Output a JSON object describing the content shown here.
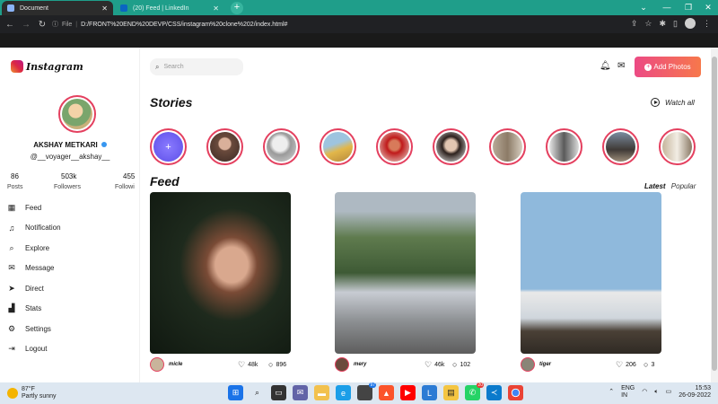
{
  "browser": {
    "tabs": [
      {
        "label": "Document",
        "active": true
      },
      {
        "label": "(20) Feed | LinkedIn",
        "active": false
      }
    ],
    "new_tab_label": "+",
    "address": {
      "scheme_label": "File",
      "url": "D:/FRONT%20END%20DEVP/CSS/instagram%20clone%202/index.html#"
    }
  },
  "sidebar": {
    "brand": "Instagram",
    "profile": {
      "name": "AKSHAY METKARI",
      "handle": "@__voyager__akshay__"
    },
    "stats": [
      {
        "value": "86",
        "label": "Posts"
      },
      {
        "value": "503k",
        "label": "Followers"
      },
      {
        "value": "455",
        "label": "Followi"
      }
    ],
    "nav": [
      {
        "label": "Feed",
        "icon": "grid-icon"
      },
      {
        "label": "Notification",
        "icon": "bell-icon"
      },
      {
        "label": "Explore",
        "icon": "search-icon"
      },
      {
        "label": "Message",
        "icon": "mail-icon"
      },
      {
        "label": "Direct",
        "icon": "send-icon"
      },
      {
        "label": "Stats",
        "icon": "stats-icon"
      },
      {
        "label": "Settings",
        "icon": "gear-icon"
      },
      {
        "label": "Logout",
        "icon": "logout-icon"
      }
    ]
  },
  "header": {
    "search_placeholder": "Search",
    "add_button": "Add Photos"
  },
  "stories": {
    "title": "Stories",
    "watch_all": "Watch all",
    "add_label": "+"
  },
  "feed": {
    "title": "Feed",
    "filter_latest": "Latest",
    "filter_popular": "Popular",
    "posts": [
      {
        "user": "micle",
        "likes": "48k",
        "comments": "896"
      },
      {
        "user": "mery",
        "likes": "46k",
        "comments": "102"
      },
      {
        "user": "tiger",
        "likes": "206",
        "comments": "3"
      }
    ]
  },
  "taskbar": {
    "weather_temp": "87°F",
    "weather_desc": "Partly sunny",
    "lang": "ENG",
    "region": "IN",
    "time": "15:53",
    "date": "26-09-2022",
    "badge_1": "97",
    "badge_2": "20"
  },
  "colors": {
    "accent": "#e4405f",
    "button_gradient_start": "#ec4a84",
    "button_gradient_end": "#f7784b",
    "tabstrip": "#1f9e8a"
  }
}
